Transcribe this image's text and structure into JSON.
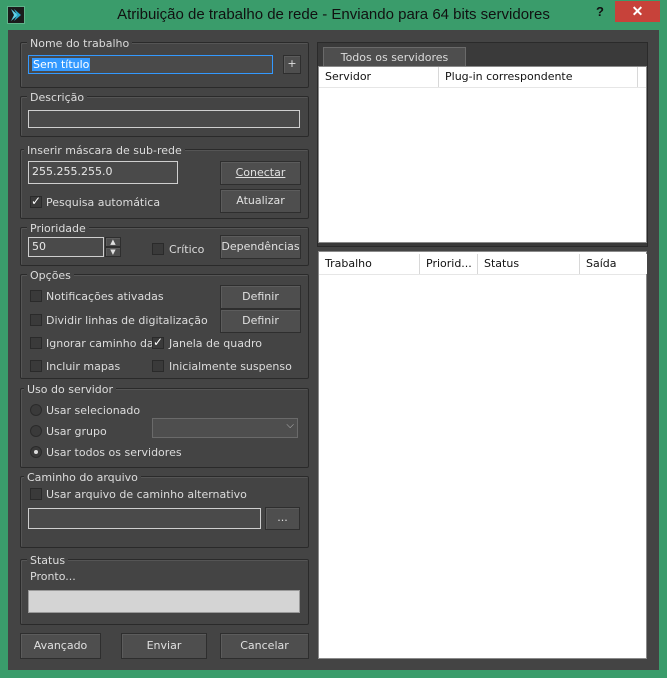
{
  "window": {
    "title": "Atribuição de trabalho de rede - Enviando para 64 bits servidores",
    "help": "?",
    "close": "✕"
  },
  "job_name": {
    "label": "Nome do trabalho",
    "value": "Sem título",
    "add": "+"
  },
  "description": {
    "label": "Descrição",
    "value": ""
  },
  "subnet": {
    "label": "Inserir máscara de sub-rede",
    "value": "255.255.255.0",
    "connect": "Conectar",
    "auto_search": "Pesquisa automática",
    "auto_search_checked": true,
    "update": "Atualizar"
  },
  "priority": {
    "label": "Prioridade",
    "value": "50",
    "critical": "Crítico",
    "critical_checked": false,
    "dependencies": "Dependências"
  },
  "options": {
    "label": "Opções",
    "notifications": "Notificações ativadas",
    "split_scanlines": "Dividir linhas de digitalização",
    "define1": "Definir",
    "define2": "Definir",
    "ignore_path": "Ignorar caminho da",
    "frame_window": "Janela de quadro",
    "include_maps": "Incluir mapas",
    "initially_suspended": "Inicialmente suspenso"
  },
  "server_usage": {
    "label": "Uso do servidor",
    "use_selected": "Usar selecionado",
    "use_group": "Usar grupo",
    "use_all": "Usar todos os servidores",
    "group_value": ""
  },
  "file_path": {
    "label": "Caminho do arquivo",
    "alt_path": "Usar arquivo de caminho alternativo",
    "value": "",
    "browse": "..."
  },
  "status": {
    "label": "Status",
    "text": "Pronto..."
  },
  "footer": {
    "advanced": "Avançado",
    "submit": "Enviar",
    "cancel": "Cancelar"
  },
  "servers_panel": {
    "tab": "Todos os servidores",
    "columns": [
      "Servidor",
      "Plug-in correspondente"
    ]
  },
  "jobs_panel": {
    "columns": [
      "Trabalho",
      "Priorid...",
      "Status",
      "Saída"
    ]
  },
  "colors": {
    "frame": "#3a9c6b",
    "close": "#c7423a",
    "panel": "#444444",
    "selection": "#3399ff"
  }
}
